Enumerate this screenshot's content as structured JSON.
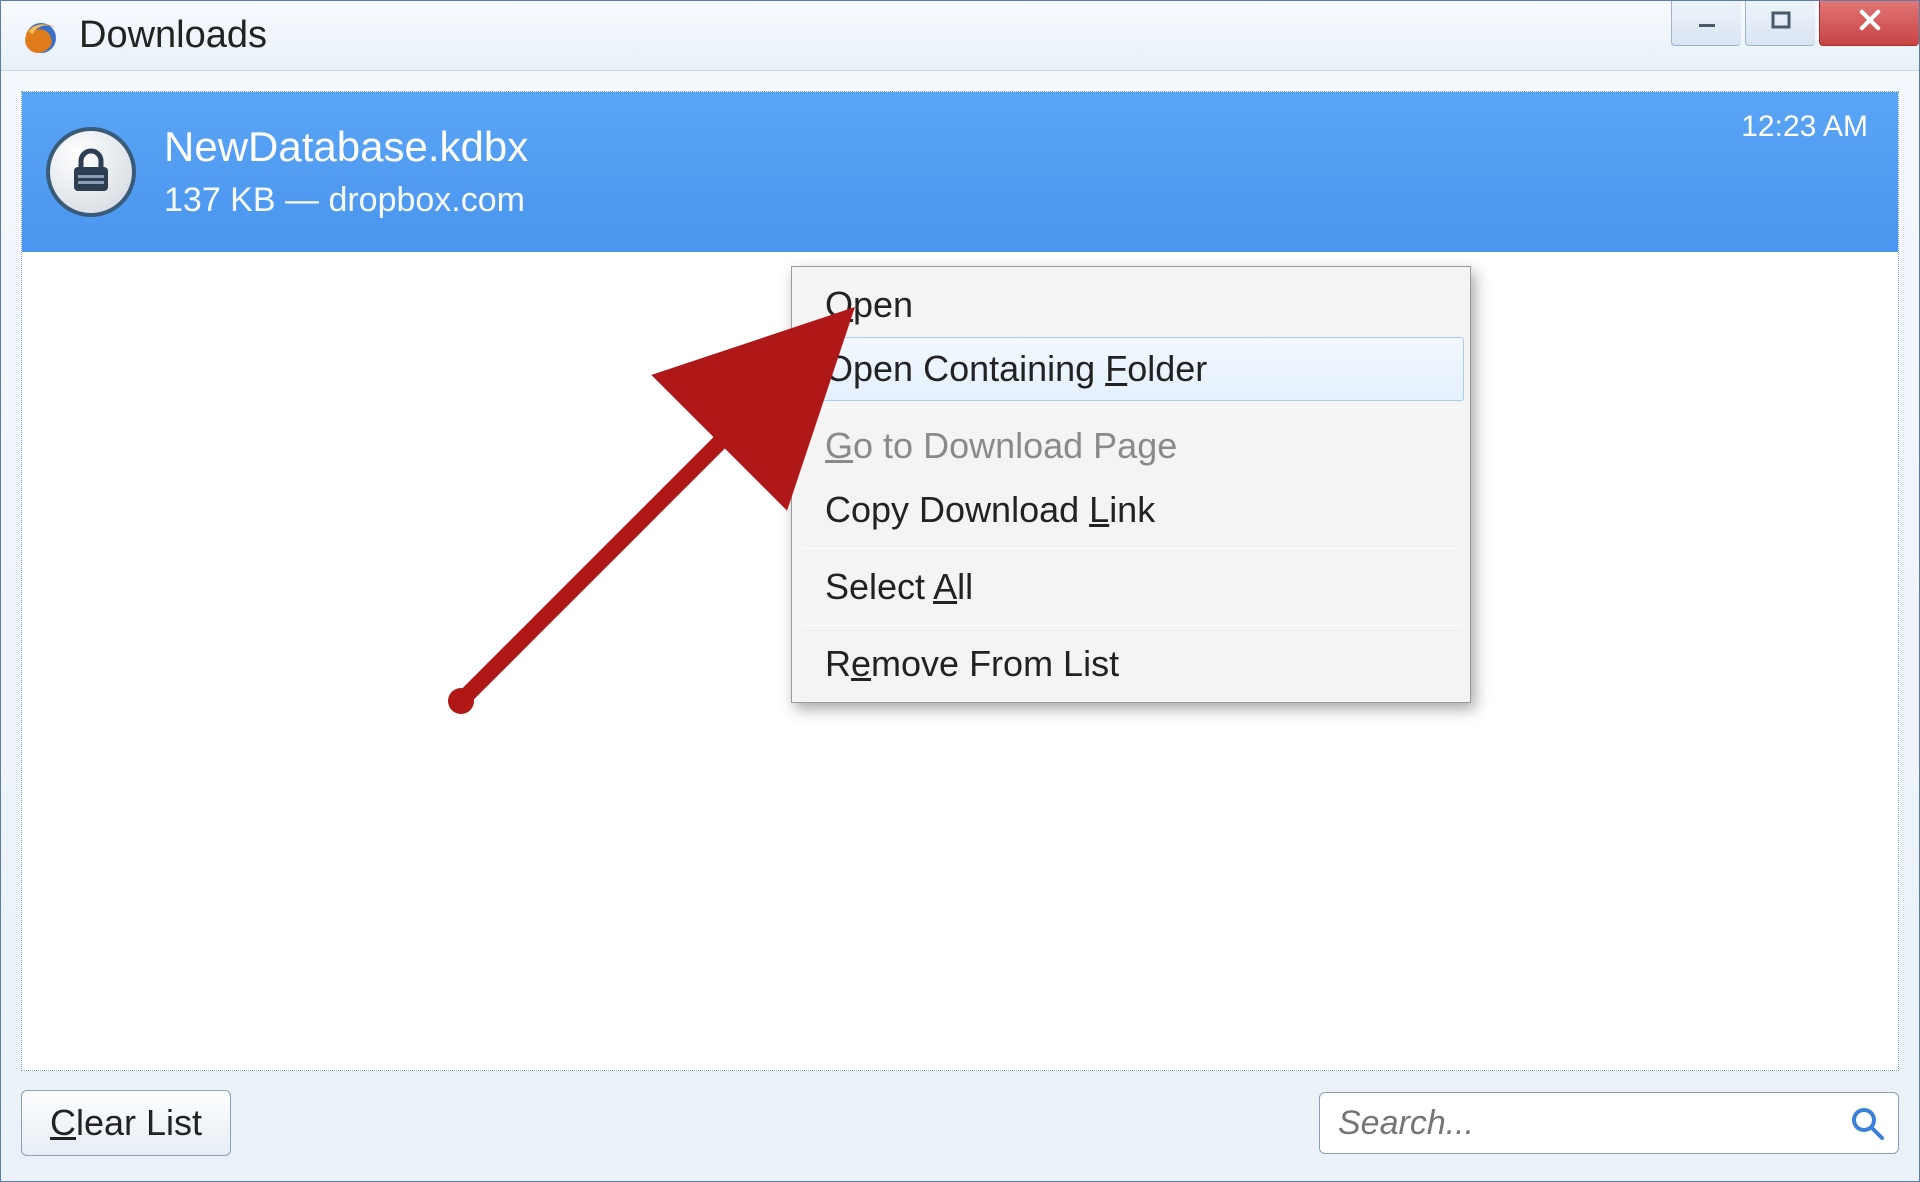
{
  "window": {
    "title": "Downloads"
  },
  "download": {
    "filename": "NewDatabase.kdbx",
    "size": "137 KB",
    "source": "dropbox.com",
    "separator": " — ",
    "time": "12:23 AM"
  },
  "context_menu": {
    "items": [
      {
        "label_pre": "",
        "accel": "O",
        "label_post": "pen",
        "disabled": false,
        "hover": false
      },
      {
        "label_pre": "Open Containing ",
        "accel": "F",
        "label_post": "older",
        "disabled": false,
        "hover": true
      },
      {
        "sep": true
      },
      {
        "label_pre": "",
        "accel": "G",
        "label_post": "o to Download Page",
        "disabled": true,
        "hover": false
      },
      {
        "label_pre": "Copy Download ",
        "accel": "L",
        "label_post": "ink",
        "disabled": false,
        "hover": false
      },
      {
        "sep": true
      },
      {
        "label_pre": "Select ",
        "accel": "A",
        "label_post": "ll",
        "disabled": false,
        "hover": false
      },
      {
        "sep": true
      },
      {
        "label_pre": "R",
        "accel": "e",
        "label_post": "move From List",
        "disabled": false,
        "hover": false
      }
    ]
  },
  "bottom": {
    "clear_pre": "",
    "clear_accel": "C",
    "clear_post": "lear List",
    "search_placeholder": "Search..."
  }
}
